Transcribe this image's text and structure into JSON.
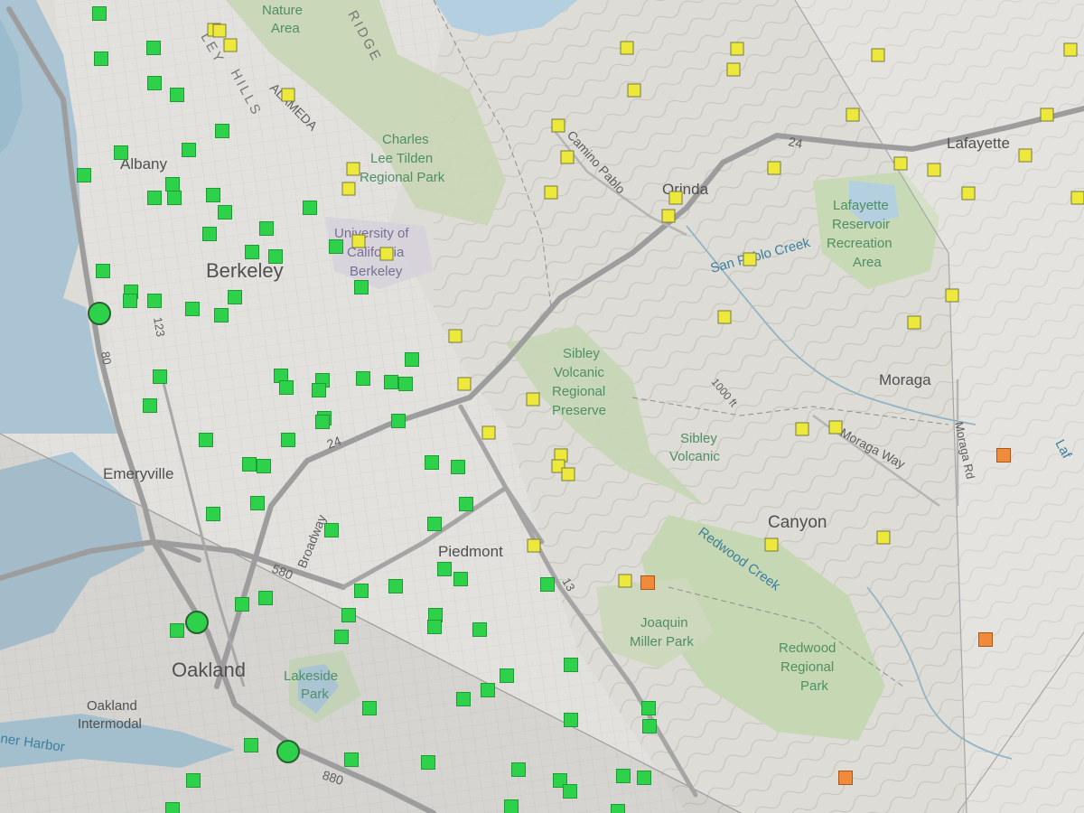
{
  "map": {
    "colors": {
      "good": "#2ed14a",
      "moderate": "#ece93c",
      "unhealthy_sensitive": "#ef8b3a",
      "marker_stroke": "#7a7a3c"
    },
    "places": {
      "albany": "Albany",
      "berkeley": "Berkeley",
      "emeryville": "Emeryville",
      "oakland": "Oakland",
      "oakland_intermodal_1": "Oakland",
      "oakland_intermodal_2": "Intermodal",
      "piedmont": "Piedmont",
      "orinda": "Orinda",
      "lafayette": "Lafayette",
      "moraga": "Moraga",
      "canyon": "Canyon",
      "laf_edge": "Laf"
    },
    "parks": {
      "nature_area_1": "Nature",
      "nature_area_2": "Area",
      "tilden_1": "Charles",
      "tilden_2": "Lee Tilden",
      "tilden_3": "Regional Park",
      "ucb_1": "University of",
      "ucb_2": "California",
      "ucb_3": "Berkeley",
      "sibley_1": "Sibley",
      "sibley_2": "Volcanic",
      "sibley_3": "Regional",
      "sibley_4": "Preserve",
      "sibley_b_1": "Sibley",
      "sibley_b_2": "Volcanic",
      "lafres_1": "Lafayette",
      "lafres_2": "Reservoir",
      "lafres_3": "Recreation",
      "lafres_4": "Area",
      "joaquin_1": "Joaquin",
      "joaquin_2": "Miller Park",
      "redwood_1": "Redwood",
      "redwood_2": "Regional",
      "redwood_3": "Park",
      "lakeside_1": "Lakeside",
      "lakeside_2": "Park"
    },
    "water": {
      "san_pablo_creek": "San Pablo Creek",
      "redwood_creek": "Redwood Creek",
      "inner_harbor": "ner Harbor"
    },
    "roads": {
      "camino_pablo": "Camino Pablo",
      "moraga_way": "Moraga Way",
      "moraga_rd": "Moraga Rd",
      "broadway": "Broadway",
      "alameda": "ALAMEDA",
      "elev": "1000 ft",
      "hw24_a": "24",
      "hw24_b": "24",
      "hw13": "13",
      "hw80": "80",
      "hw123": "123",
      "hw580": "580",
      "hw880": "880"
    },
    "ridges": {
      "hills": "HILLS",
      "ridge": "RIDGE",
      "ley": "LEY"
    }
  }
}
